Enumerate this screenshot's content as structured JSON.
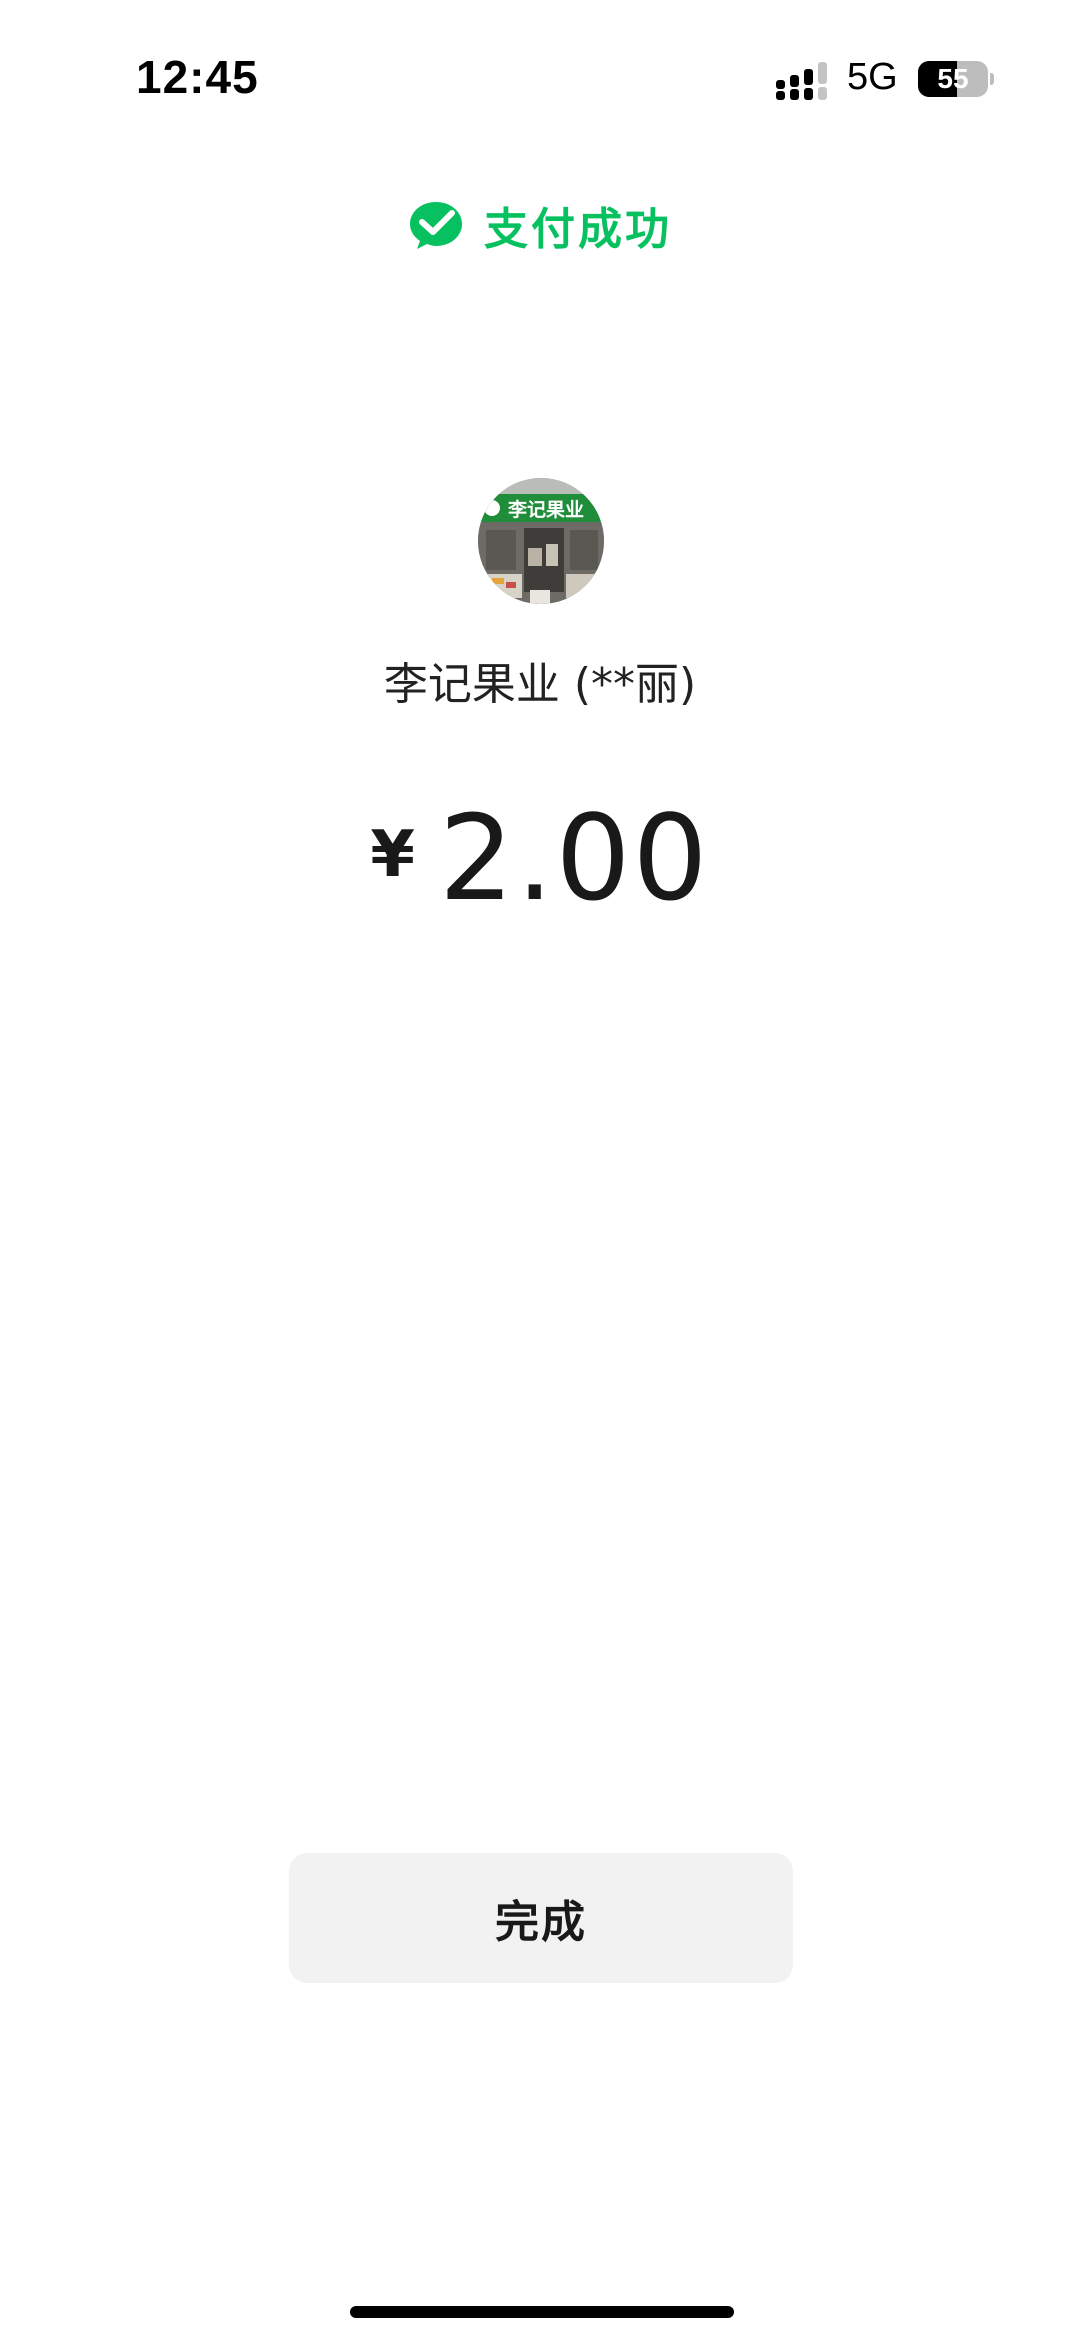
{
  "status_bar": {
    "time": "12:45",
    "network": "5G",
    "battery_level": "55",
    "battery_fraction": 0.55
  },
  "header": {
    "icon": "wechat-pay-icon",
    "title": "支付成功",
    "accent_color": "#07c160"
  },
  "merchant": {
    "avatar": "store-avatar",
    "avatar_sign_text": "李记果业",
    "name": "李记果业 (**丽)"
  },
  "payment": {
    "currency_symbol": "¥",
    "amount": "2.00"
  },
  "actions": {
    "done_label": "完成"
  }
}
